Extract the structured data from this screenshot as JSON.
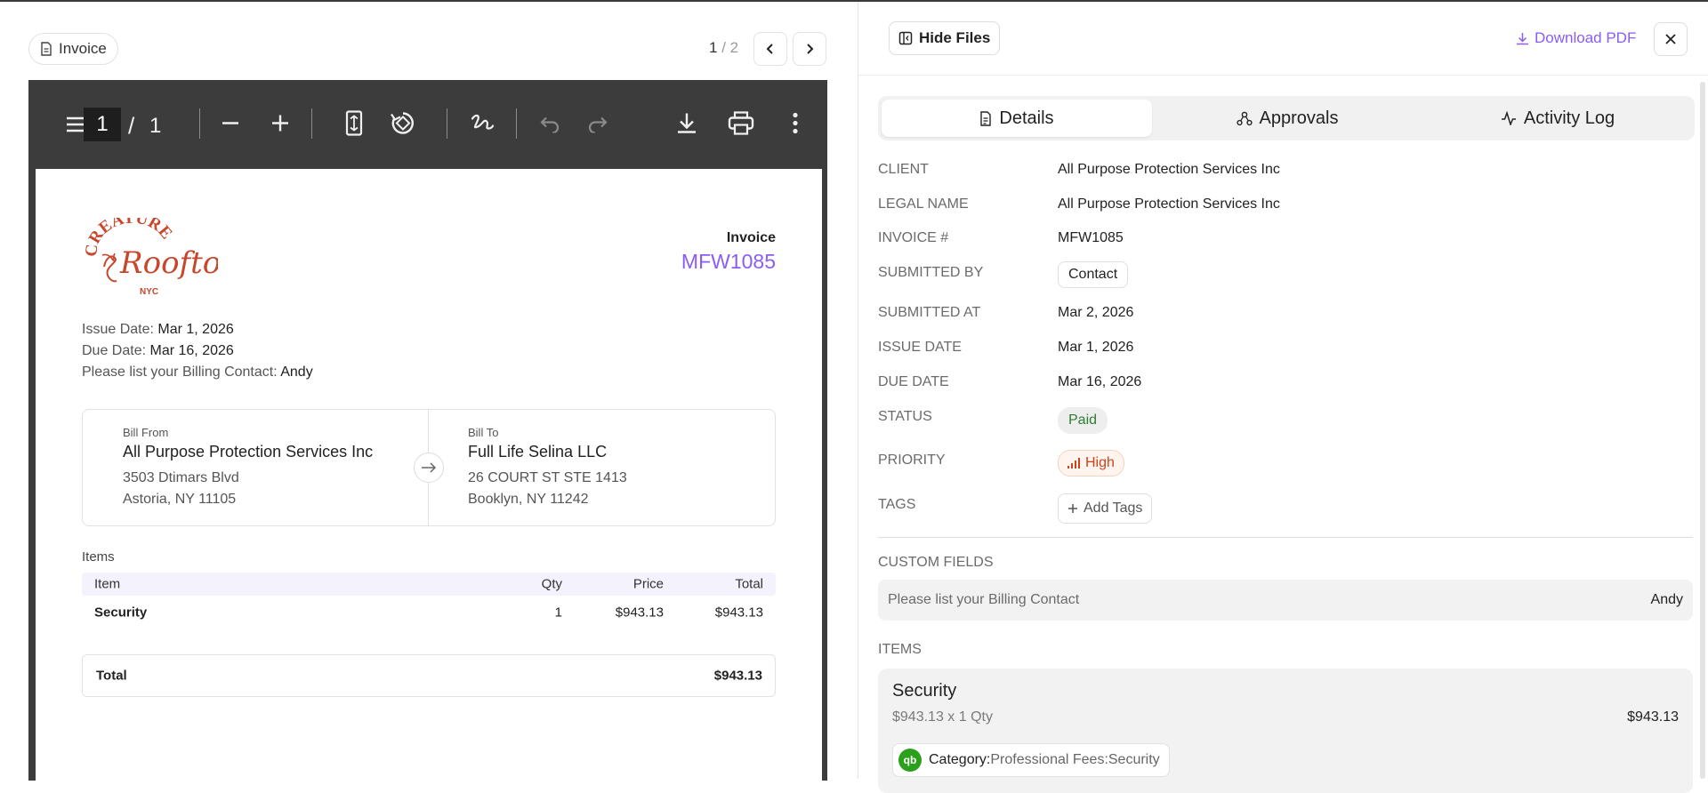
{
  "left_header": {
    "doc_tab_label": "Invoice",
    "pager_current": "1",
    "pager_sep": " / ",
    "pager_total": "2"
  },
  "pdf_toolbar": {
    "page_input": "1",
    "page_sep": "/",
    "page_total": "1"
  },
  "invoice": {
    "logo": {
      "line1": "CREATURES",
      "line2": "Rooftop",
      "line3": "NYC"
    },
    "label": "Invoice",
    "number": "MFW1085",
    "issue_label": "Issue Date:",
    "issue_value": "Mar 1, 2026",
    "due_label": "Due Date:",
    "due_value": "Mar 16, 2026",
    "billing_label": "Please list your Billing Contact:",
    "billing_value": "Andy",
    "bill_from": {
      "label": "Bill From",
      "name": "All Purpose Protection Services Inc",
      "addr1": "3503 Dtimars Blvd",
      "addr2": "Astoria, NY 11105"
    },
    "bill_to": {
      "label": "Bill To",
      "name": "Full Life Selina LLC",
      "addr1": "26 COURT ST STE 1413",
      "addr2": "Booklyn, NY 11242"
    },
    "items_label": "Items",
    "columns": {
      "item": "Item",
      "qty": "Qty",
      "price": "Price",
      "total": "Total"
    },
    "rows": [
      {
        "item": "Security",
        "qty": "1",
        "price": "$943.13",
        "total": "$943.13"
      }
    ],
    "total_label": "Total",
    "total_value": "$943.13"
  },
  "right_header": {
    "hide_files": "Hide Files",
    "download_pdf": "Download PDF"
  },
  "tabs": [
    {
      "label": "Details",
      "icon": "document-icon",
      "active": true
    },
    {
      "label": "Approvals",
      "icon": "approvals-icon",
      "active": false
    },
    {
      "label": "Activity Log",
      "icon": "activity-icon",
      "active": false
    }
  ],
  "details": {
    "client_label": "CLIENT",
    "client_value": "All Purpose Protection Services Inc",
    "legal_label": "LEGAL NAME",
    "legal_value": "All Purpose Protection Services Inc",
    "invno_label": "INVOICE #",
    "invno_value": "MFW1085",
    "submitted_by_label": "SUBMITTED BY",
    "submitted_by_value": "Contact",
    "submitted_at_label": "SUBMITTED AT",
    "submitted_at_value": "Mar 2, 2026",
    "issue_label": "ISSUE DATE",
    "issue_value": "Mar 1, 2026",
    "due_label": "DUE DATE",
    "due_value": "Mar 16, 2026",
    "status_label": "STATUS",
    "status_value": "Paid",
    "priority_label": "PRIORITY",
    "priority_value": "High",
    "tags_label": "TAGS",
    "add_tags": "Add Tags"
  },
  "custom_fields": {
    "label": "CUSTOM FIELDS",
    "field_name": "Please list your Billing Contact",
    "field_value": "Andy"
  },
  "items_section": {
    "label": "ITEMS",
    "item_name": "Security",
    "item_sub": "$943.13 x 1 Qty",
    "item_price": "$943.13",
    "category_label": "Category:",
    "category_value": "Professional Fees:Security",
    "qb_badge": "qb"
  },
  "colors": {
    "accent": "#8b5cf6",
    "paid": "#2e7d32",
    "high": "#d0421b",
    "logo": "#c8462b",
    "toolbar": "#3c3c3c"
  }
}
